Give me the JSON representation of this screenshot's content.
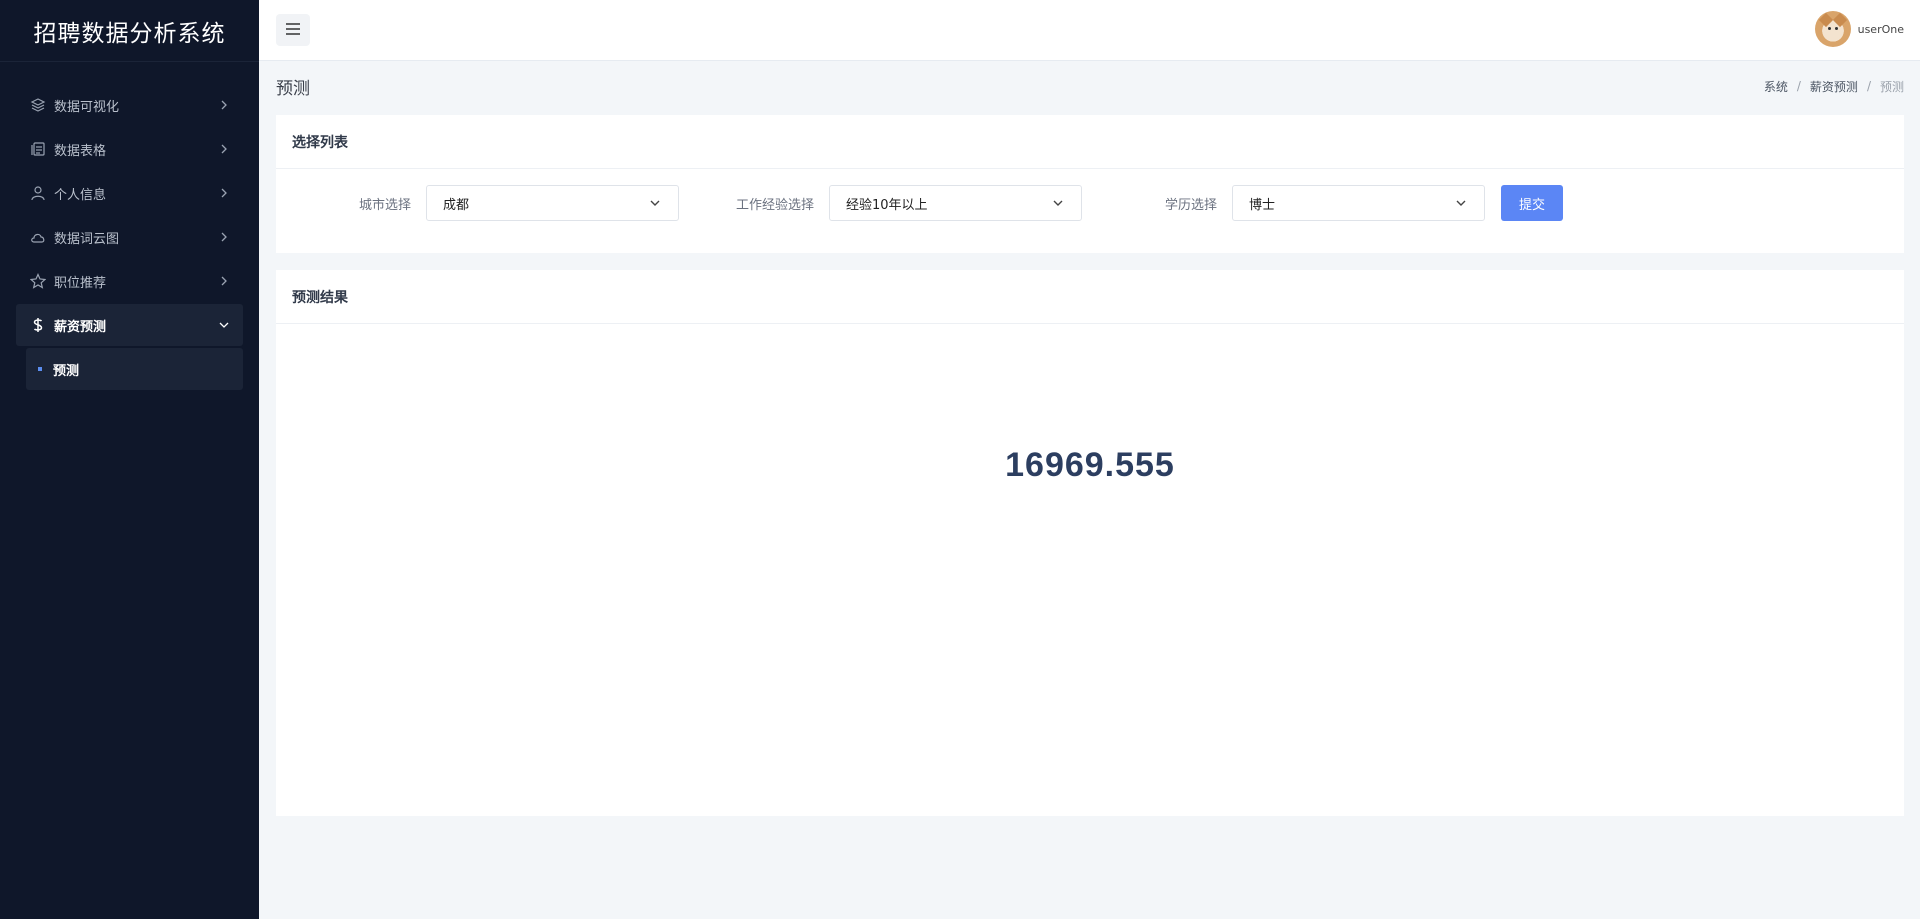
{
  "app": {
    "title": "招聘数据分析系统"
  },
  "sidebar": {
    "items": [
      {
        "label": "数据可视化",
        "icon": "layers-icon"
      },
      {
        "label": "数据表格",
        "icon": "table-icon"
      },
      {
        "label": "个人信息",
        "icon": "user-icon"
      },
      {
        "label": "数据词云图",
        "icon": "cloud-icon"
      },
      {
        "label": "职位推荐",
        "icon": "star-icon"
      },
      {
        "label": "薪资预测",
        "icon": "dollar-icon",
        "expanded": true
      }
    ],
    "submenu": {
      "label": "预测",
      "active": true
    }
  },
  "topbar": {
    "username": "userOne"
  },
  "page": {
    "title": "预测",
    "breadcrumb": [
      "系统",
      "薪资预测",
      "预测"
    ]
  },
  "form_card": {
    "title": "选择列表",
    "city": {
      "label": "城市选择",
      "value": "成都"
    },
    "experience": {
      "label": "工作经验选择",
      "value": "经验10年以上"
    },
    "education": {
      "label": "学历选择",
      "value": "博士"
    },
    "submit_label": "提交"
  },
  "result_card": {
    "title": "预测结果",
    "value": "16969.555"
  },
  "colors": {
    "sidebar_bg": "#0f172a",
    "accent": "#5b86f5",
    "page_bg": "#f3f6f9"
  }
}
